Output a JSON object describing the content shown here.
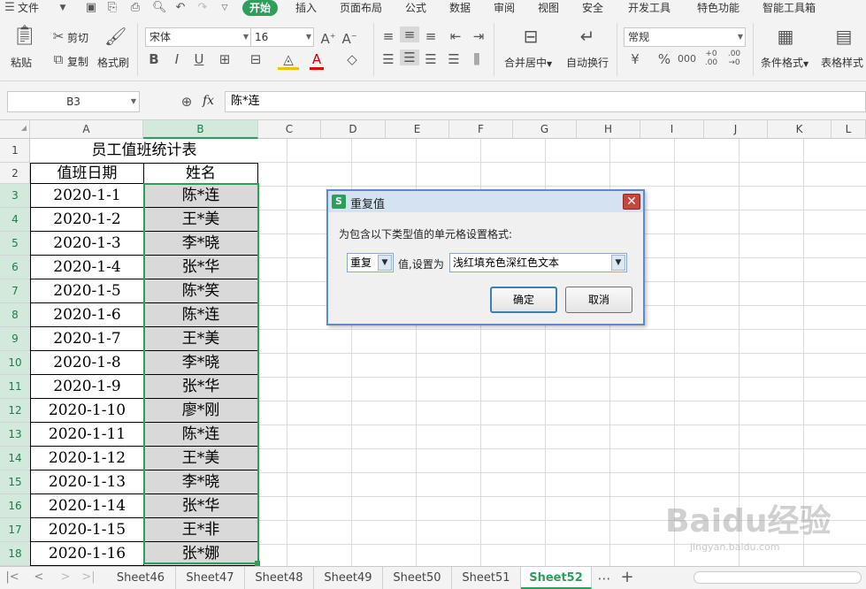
{
  "menubar": {
    "file": "文件",
    "tabs": [
      "开始",
      "插入",
      "页面布局",
      "公式",
      "数据",
      "审阅",
      "视图",
      "安全",
      "开发工具",
      "特色功能",
      "智能工具箱"
    ]
  },
  "ribbon": {
    "paste": "粘贴",
    "cut": "剪切",
    "copy": "复制",
    "format_painter": "格式刷",
    "font_name": "宋体",
    "font_size": "16",
    "number_format": "常规",
    "merge_center": "合并居中",
    "wrap_text": "自动换行",
    "conditional_format": "条件格式",
    "table_style": "表格样式"
  },
  "formula_bar": {
    "name_box": "B3",
    "fx": "fx",
    "value": "陈*连"
  },
  "columns": [
    "A",
    "B",
    "C",
    "D",
    "E",
    "F",
    "G",
    "H",
    "I",
    "J",
    "K",
    "L"
  ],
  "rows": [
    "1",
    "2",
    "3",
    "4",
    "5",
    "6",
    "7",
    "8",
    "9",
    "10",
    "11",
    "12",
    "13",
    "14",
    "15",
    "16",
    "17",
    "18"
  ],
  "sheet": {
    "title": "员工值班统计表",
    "headers": [
      "值班日期",
      "姓名"
    ],
    "records": [
      [
        "2020-1-1",
        "陈*连"
      ],
      [
        "2020-1-2",
        "王*美"
      ],
      [
        "2020-1-3",
        "李*晓"
      ],
      [
        "2020-1-4",
        "张*华"
      ],
      [
        "2020-1-5",
        "陈*笑"
      ],
      [
        "2020-1-6",
        "陈*连"
      ],
      [
        "2020-1-7",
        "王*美"
      ],
      [
        "2020-1-8",
        "李*晓"
      ],
      [
        "2020-1-9",
        "张*华"
      ],
      [
        "2020-1-10",
        "廖*刚"
      ],
      [
        "2020-1-11",
        "陈*连"
      ],
      [
        "2020-1-12",
        "王*美"
      ],
      [
        "2020-1-13",
        "李*晓"
      ],
      [
        "2020-1-14",
        "张*华"
      ],
      [
        "2020-1-15",
        "王*非"
      ],
      [
        "2020-1-16",
        "张*娜"
      ]
    ]
  },
  "dialog": {
    "title": "重复值",
    "prompt": "为包含以下类型值的单元格设置格式:",
    "type_value": "重复",
    "set_as_label": "值,设置为",
    "format_value": "浅红填充色深红色文本",
    "ok": "确定",
    "cancel": "取消",
    "icon_letter": "S"
  },
  "sheet_tabs": [
    "Sheet46",
    "Sheet47",
    "Sheet48",
    "Sheet49",
    "Sheet50",
    "Sheet51",
    "Sheet52"
  ],
  "active_sheet": "Sheet52",
  "watermark": {
    "logo": "Baidu经验",
    "url": "jingyan.baidu.com"
  },
  "colors": {
    "accent": "#2e9e5b",
    "selection_fill": "#d9d9d9",
    "dialog_border": "#5a8ccf"
  }
}
